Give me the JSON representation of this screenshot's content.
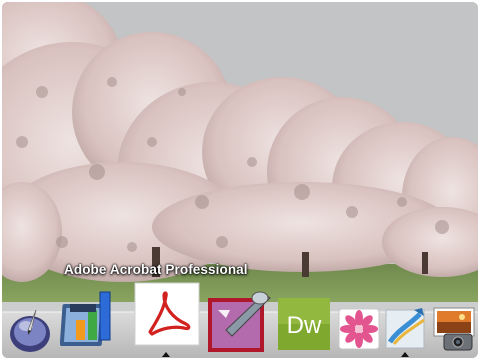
{
  "wallpaper": {
    "description_icon": "cherry-blossom-trees-photo"
  },
  "dock": {
    "tooltip": "Adobe Acrobat Professional",
    "apps": [
      {
        "name": "Script Editor",
        "icon": "script-editor-icon",
        "running": false
      },
      {
        "name": "Numbers",
        "icon": "numbers-icon",
        "running": false
      },
      {
        "name": "Adobe Acrobat Professional",
        "icon": "acrobat-icon",
        "running": true
      },
      {
        "name": "Adobe Illustrator",
        "icon": "illustrator-icon",
        "running": false
      },
      {
        "name": "Dreamweaver",
        "icon": "dreamweaver-icon",
        "label": "Dw",
        "running": false
      },
      {
        "name": "Photo Booth",
        "icon": "flower-icon",
        "running": false
      },
      {
        "name": "Photoshop",
        "icon": "photoshop-icon",
        "running": true
      },
      {
        "name": "iPhoto",
        "icon": "iphoto-icon",
        "running": false
      }
    ]
  },
  "colors": {
    "dreamweaver": "#7fa82e",
    "acrobat": "#d2221f",
    "blossom": "#e7d5d3",
    "sky": "#c3c4c5"
  }
}
